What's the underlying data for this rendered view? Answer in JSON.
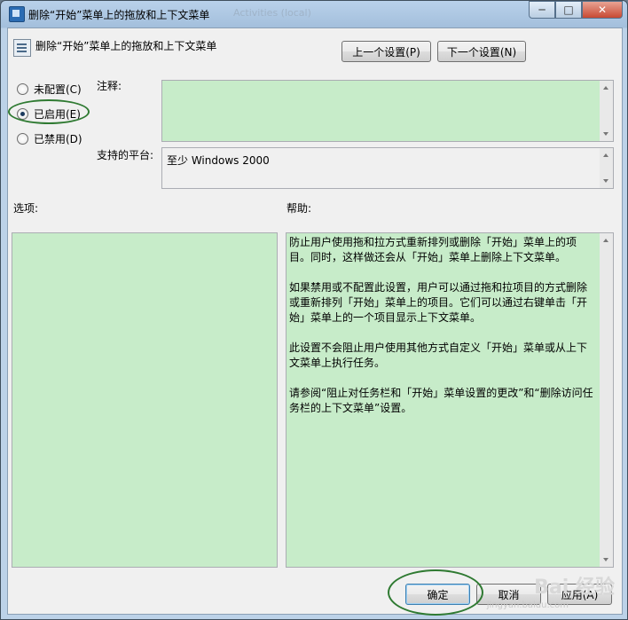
{
  "window": {
    "title": "删除“开始”菜单上的拖放和上下文菜单",
    "ghost_title": "Activities (local)",
    "controls": {
      "minimize": "─",
      "maximize": "□",
      "close": "✕"
    }
  },
  "header": {
    "policy_title": "删除“开始”菜单上的拖放和上下文菜单",
    "prev_button": "上一个设置(P)",
    "next_button": "下一个设置(N)"
  },
  "state": {
    "not_configured": "未配置(C)",
    "enabled": "已启用(E)",
    "disabled": "已禁用(D)",
    "selected": "enabled"
  },
  "comment": {
    "label": "注释:",
    "value": ""
  },
  "platform": {
    "label": "支持的平台:",
    "value": "至少 Windows 2000"
  },
  "options": {
    "label": "选项:"
  },
  "help": {
    "label": "帮助:",
    "paragraphs": [
      "防止用户使用拖和拉方式重新排列或删除「开始」菜单上的项目。同时，这样做还会从「开始」菜单上删除上下文菜单。",
      "如果禁用或不配置此设置，用户可以通过拖和拉项目的方式删除或重新排列「开始」菜单上的项目。它们可以通过右键单击「开始」菜单上的一个项目显示上下文菜单。",
      "此设置不会阻止用户使用其他方式自定义「开始」菜单或从上下文菜单上执行任务。",
      "请参阅“阻止对任务栏和「开始」菜单设置的更改”和“删除访问任务栏的上下文菜单”设置。"
    ]
  },
  "footer": {
    "ok": "确定",
    "cancel": "取消",
    "apply": "应用(A)"
  },
  "watermark": {
    "text": "Bai 经验",
    "url": "jingyan.baidu.com"
  },
  "colors": {
    "textbox_bg": "#c7ecc9",
    "annotation": "#2f7a32"
  }
}
